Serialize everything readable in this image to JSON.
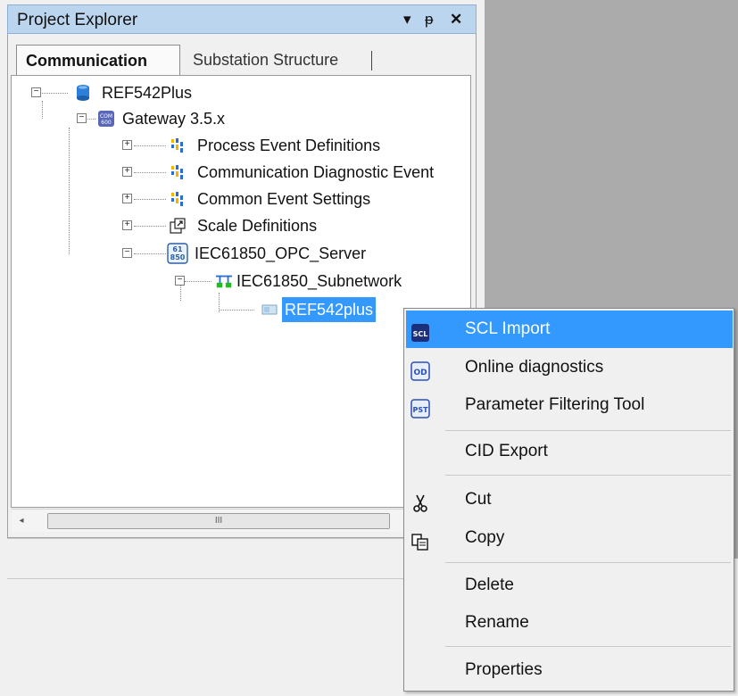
{
  "panel": {
    "title": "Project Explorer",
    "controls": {
      "dropdown": "▾",
      "pin": "ᵽ",
      "close": "✕"
    },
    "tabs": [
      {
        "label": "Communication",
        "active": true
      },
      {
        "label": "Substation Structure",
        "active": false
      }
    ]
  },
  "tree": {
    "nodes": [
      {
        "label": "REF542Plus",
        "icon": "database-icon",
        "expander": "−"
      },
      {
        "label": "Gateway 3.5.x",
        "icon": "com600-icon",
        "expander": "−"
      },
      {
        "label": "Process Event Definitions",
        "icon": "event-definitions-icon",
        "expander": "+"
      },
      {
        "label": "Communication Diagnostic Event",
        "icon": "event-definitions-icon",
        "expander": "+"
      },
      {
        "label": "Common Event Settings",
        "icon": "event-definitions-icon",
        "expander": "+"
      },
      {
        "label": "Scale Definitions",
        "icon": "scale-icon",
        "expander": "+"
      },
      {
        "label": "IEC61850_OPC_Server",
        "icon": "iec61850-icon",
        "expander": "−"
      },
      {
        "label": "IEC61850_Subnetwork",
        "icon": "network-icon",
        "expander": "−"
      },
      {
        "label": "REF542plus",
        "icon": "device-icon",
        "expander": "",
        "selected": true
      }
    ],
    "scrollbar": {
      "left": "◂",
      "right": "▸",
      "thumb": "III"
    }
  },
  "context_menu": {
    "items": [
      {
        "label": "SCL Import",
        "icon": "scl-icon",
        "icon_text": "SCL",
        "highlight": true
      },
      {
        "label": "Online diagnostics",
        "icon": "od-icon",
        "icon_text": "OD"
      },
      {
        "label": "Parameter Filtering Tool",
        "icon": "pst-icon",
        "icon_text": "PST"
      },
      {
        "label": "CID Export"
      },
      {
        "label": "Cut",
        "icon": "scissors-icon"
      },
      {
        "label": "Copy",
        "icon": "copy-icon"
      },
      {
        "label": "Delete"
      },
      {
        "label": "Rename"
      },
      {
        "label": "Properties"
      }
    ]
  },
  "colors": {
    "selection": "#3399ff",
    "title_bar": "#bcd5ee",
    "workspace": "#ababab"
  }
}
